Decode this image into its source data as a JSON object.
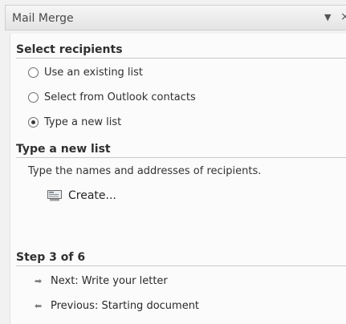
{
  "pane": {
    "title": "Mail Merge",
    "dropdown_icon": "▼",
    "close_icon": "×"
  },
  "select_recipients": {
    "heading": "Select recipients",
    "options": [
      {
        "label": "Use an existing list",
        "checked": false
      },
      {
        "label": "Select from Outlook contacts",
        "checked": false
      },
      {
        "label": "Type a new list",
        "checked": true
      }
    ]
  },
  "type_new_list": {
    "heading": "Type a new list",
    "description": "Type the names and addresses of recipients.",
    "create_label": "Create..."
  },
  "step": {
    "heading": "Step 3 of 6",
    "next_label": "Next: Write your letter",
    "previous_label": "Previous: Starting document"
  }
}
